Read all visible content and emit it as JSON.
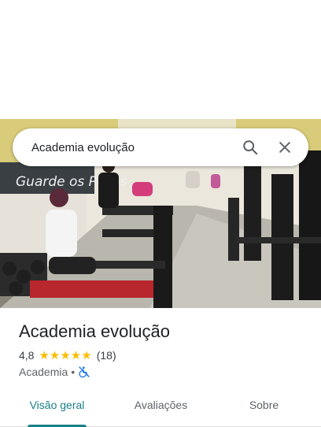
{
  "search": {
    "query": "Academia evolução"
  },
  "place": {
    "name": "Academia evolução",
    "rating": "4,8",
    "stars": "★★★★★",
    "review_count": "(18)",
    "category": "Academia",
    "separator": "•"
  },
  "tabs": [
    {
      "label": "Visão geral"
    },
    {
      "label": "Avaliações"
    },
    {
      "label": "Sobre"
    }
  ],
  "photo": {
    "wall_text": "Guarde os Pesos"
  },
  "colors": {
    "accent": "#1a7f87",
    "star": "#fbbc04",
    "accessibility": "#1a73e8"
  }
}
